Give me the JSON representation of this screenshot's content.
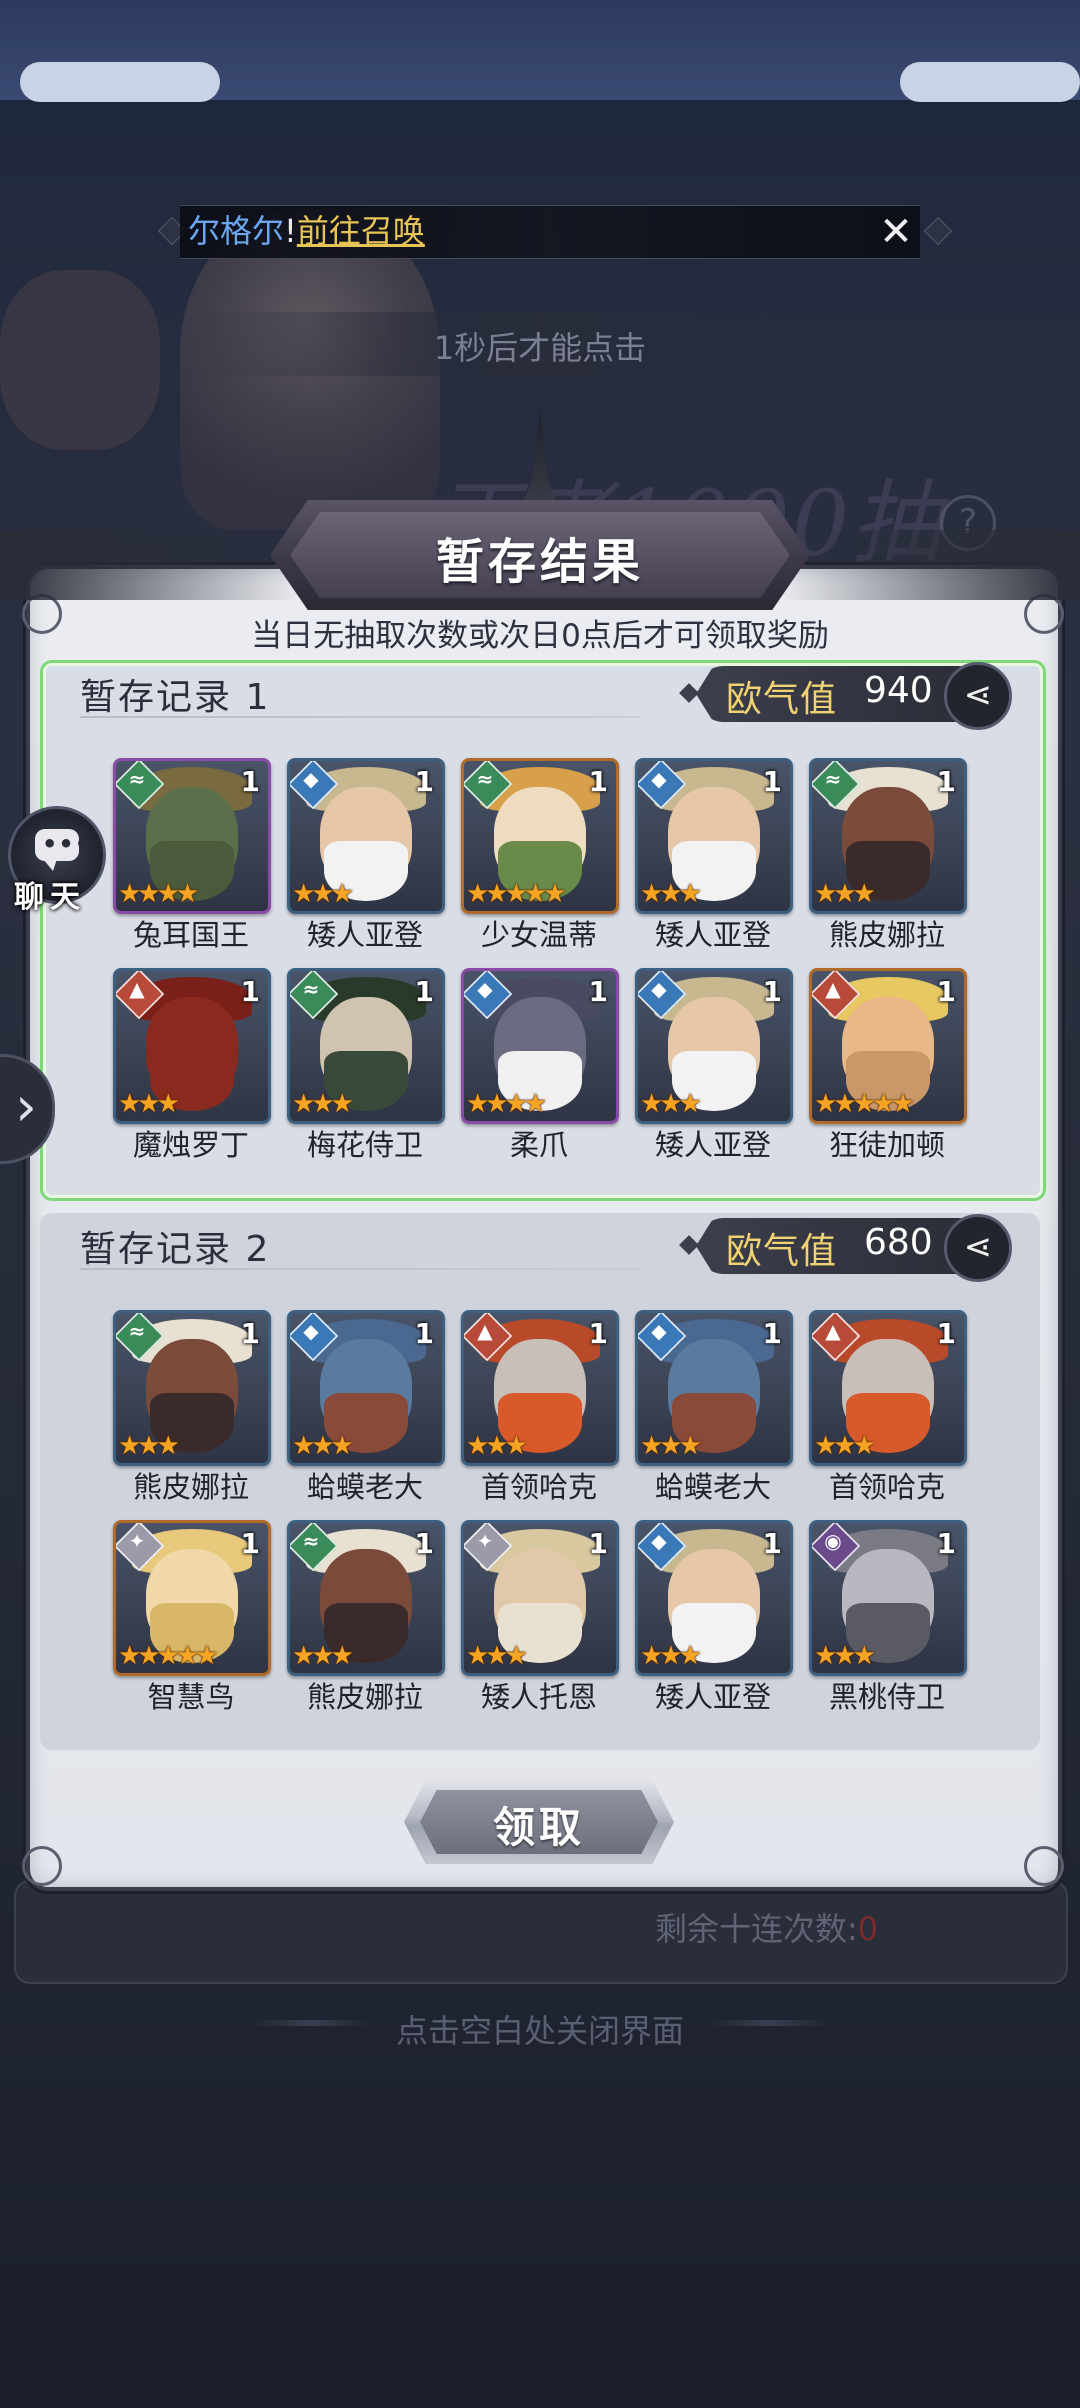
{
  "marquee": {
    "name": "尔格尔",
    "separator": "!",
    "link": "前往召唤",
    "close_icon": "✕"
  },
  "top_hint": "1秒后才能点击",
  "background_event_text": "王者1000抽",
  "chat": {
    "label": "聊天"
  },
  "side_arrow": "›",
  "panel": {
    "title": "暂存结果",
    "subtitle": "当日无抽取次数或次日0点后才可领取奖励",
    "claim_button": "领取"
  },
  "records": [
    {
      "title": "暂存记录 1",
      "luck_label": "欧气值",
      "luck_value": "940",
      "selected": true,
      "heroes": [
        {
          "name": "兔耳国王",
          "count": "1",
          "stars": "★★★★",
          "element": "wind",
          "element_color": "#3a8a5a",
          "frame": "purple",
          "face": "#5a6e4a",
          "hat": "#7a6a40",
          "beard": "#4a5a3a"
        },
        {
          "name": "矮人亚登",
          "count": "1",
          "stars": "★★★",
          "element": "water",
          "element_color": "#3a78b8",
          "frame": "blue",
          "face": "#e6c8a8",
          "hat": "#c8b890",
          "beard": "#f2f2f2"
        },
        {
          "name": "少女温蒂",
          "count": "1",
          "stars": "★★★★★",
          "element": "wind",
          "element_color": "#3a8a5a",
          "frame": "orange",
          "face": "#f0dcc0",
          "hat": "#d8a04a",
          "beard": "#6a8a4a"
        },
        {
          "name": "矮人亚登",
          "count": "1",
          "stars": "★★★",
          "element": "water",
          "element_color": "#3a78b8",
          "frame": "blue",
          "face": "#e6c8a8",
          "hat": "#c8b890",
          "beard": "#f2f2f2"
        },
        {
          "name": "熊皮娜拉",
          "count": "1",
          "stars": "★★★",
          "element": "wind",
          "element_color": "#3a8a5a",
          "frame": "blue",
          "face": "#7a4a3a",
          "hat": "#e8e0d0",
          "beard": "#3a2a2a"
        },
        {
          "name": "魔烛罗丁",
          "count": "1",
          "stars": "★★★",
          "element": "fire",
          "element_color": "#b84a3a",
          "frame": "blue",
          "face": "#8a2a1e",
          "hat": "#7a2018",
          "beard": "#8a2a1e"
        },
        {
          "name": "梅花侍卫",
          "count": "1",
          "stars": "★★★",
          "element": "wind",
          "element_color": "#3a8a5a",
          "frame": "blue",
          "face": "#d0c4b0",
          "hat": "#2a3a2a",
          "beard": "#3a4a3a"
        },
        {
          "name": "柔爪",
          "count": "1",
          "stars": "★★★★",
          "element": "water",
          "element_color": "#3a78b8",
          "frame": "purple",
          "face": "#6a6a80",
          "hat": "#4a4a60",
          "beard": "#f0f0f0"
        },
        {
          "name": "矮人亚登",
          "count": "1",
          "stars": "★★★",
          "element": "water",
          "element_color": "#3a78b8",
          "frame": "blue",
          "face": "#e6c8a8",
          "hat": "#c8b890",
          "beard": "#f2f2f2"
        },
        {
          "name": "狂徒加顿",
          "count": "1",
          "stars": "★★★★★",
          "element": "fire",
          "element_color": "#b84a3a",
          "frame": "orange",
          "face": "#e8b888",
          "hat": "#e8c860",
          "beard": "#c89868"
        }
      ]
    },
    {
      "title": "暂存记录 2",
      "luck_label": "欧气值",
      "luck_value": "680",
      "selected": false,
      "heroes": [
        {
          "name": "熊皮娜拉",
          "count": "1",
          "stars": "★★★",
          "element": "wind",
          "element_color": "#3a8a5a",
          "frame": "blue",
          "face": "#7a4a3a",
          "hat": "#e8e0d0",
          "beard": "#3a2a2a"
        },
        {
          "name": "蛤蟆老大",
          "count": "1",
          "stars": "★★★",
          "element": "water",
          "element_color": "#3a78b8",
          "frame": "blue",
          "face": "#5a7aa0",
          "hat": "#4a6890",
          "beard": "#8a4a3a"
        },
        {
          "name": "首领哈克",
          "count": "1",
          "stars": "★★★",
          "element": "fire",
          "element_color": "#b84a3a",
          "frame": "blue",
          "face": "#c8c0b8",
          "hat": "#b84a2a",
          "beard": "#d85a2a"
        },
        {
          "name": "蛤蟆老大",
          "count": "1",
          "stars": "★★★",
          "element": "water",
          "element_color": "#3a78b8",
          "frame": "blue",
          "face": "#5a7aa0",
          "hat": "#4a6890",
          "beard": "#8a4a3a"
        },
        {
          "name": "首领哈克",
          "count": "1",
          "stars": "★★★",
          "element": "fire",
          "element_color": "#b84a3a",
          "frame": "blue",
          "face": "#c8c0b8",
          "hat": "#b84a2a",
          "beard": "#d85a2a"
        },
        {
          "name": "智慧鸟",
          "count": "1",
          "stars": "★★★★★",
          "element": "light",
          "element_color": "#9a9aa8",
          "frame": "orange",
          "face": "#f0d8a8",
          "hat": "#e8c87a",
          "beard": "#d8b868"
        },
        {
          "name": "熊皮娜拉",
          "count": "1",
          "stars": "★★★",
          "element": "wind",
          "element_color": "#3a8a5a",
          "frame": "blue",
          "face": "#7a4a3a",
          "hat": "#e8e0d0",
          "beard": "#3a2a2a"
        },
        {
          "name": "矮人托恩",
          "count": "1",
          "stars": "★★★",
          "element": "light",
          "element_color": "#9a9aa8",
          "frame": "blue",
          "face": "#e0c8a8",
          "hat": "#d8c8a0",
          "beard": "#e8e0d0"
        },
        {
          "name": "矮人亚登",
          "count": "1",
          "stars": "★★★",
          "element": "water",
          "element_color": "#3a78b8",
          "frame": "blue",
          "face": "#e6c8a8",
          "hat": "#c8b890",
          "beard": "#f2f2f2"
        },
        {
          "name": "黑桃侍卫",
          "count": "1",
          "stars": "★★★",
          "element": "dark",
          "element_color": "#6a4a8a",
          "frame": "blue",
          "face": "#b8b8c0",
          "hat": "#7a7a84",
          "beard": "#5a5a64"
        }
      ]
    }
  ],
  "footer": {
    "remaining_label": "剩余十连次数:",
    "remaining_value": "0",
    "close_hint": "点击空白处关闭界面"
  }
}
